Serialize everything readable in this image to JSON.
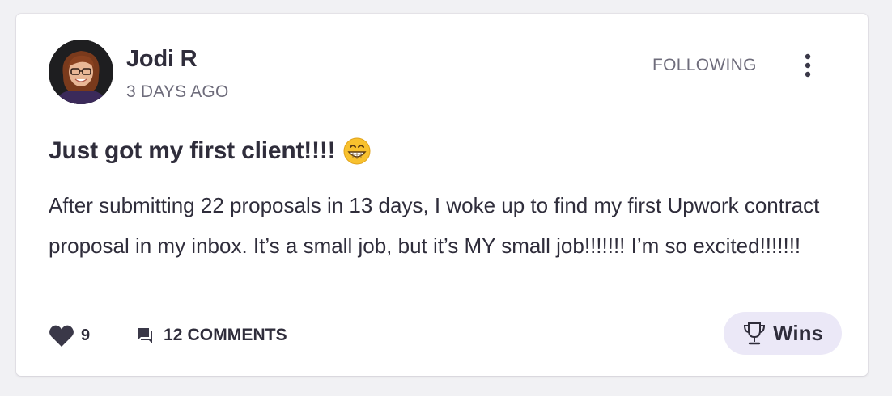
{
  "post": {
    "author": {
      "name": "Jodi R",
      "avatar_icon": "avatar-photo"
    },
    "timestamp": "3 DAYS AGO",
    "follow_label": "FOLLOWING",
    "more_icon": "vertical-ellipsis-icon",
    "title": "Just got my first client!!!!",
    "title_emoji": "grinning-face-emoji",
    "body": "After submitting 22 proposals in 13 days, I woke up to find my first Upwork contract proposal in my inbox. It’s a small job, but it’s MY small job!!!!!!! I’m so excited!!!!!!!",
    "likes": {
      "icon": "heart-icon",
      "count": "9"
    },
    "comments": {
      "icon": "comment-icon",
      "label": "12 COMMENTS"
    },
    "tag": {
      "icon": "trophy-icon",
      "label": "Wins"
    }
  },
  "colors": {
    "background": "#f1f1f4",
    "card": "#ffffff",
    "text_primary": "#2f2d3b",
    "text_secondary": "#6e6c7b",
    "tag_background": "#ebe8f7"
  }
}
